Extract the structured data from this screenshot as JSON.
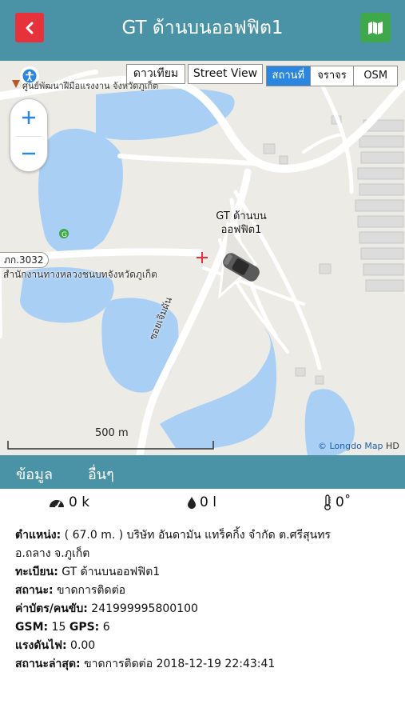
{
  "header": {
    "title": "GT ด้านบนออฟฟิต1",
    "colors": {
      "bar": "#4a92a5",
      "back": "#e5323b",
      "map_button": "#3fa84a"
    }
  },
  "map": {
    "satellite_label": "ดาวเทียม",
    "street_view_label": "Street View",
    "layers": [
      "สถานที่",
      "จราจร",
      "OSM"
    ],
    "active_layer": "สถานที่",
    "poi_top": "ศูนย์พัฒนาฝีมือแรงงาน จังหวัดภูเก็ต",
    "road_tag": "ภก.3032",
    "poi_office": "สำนักงานทางหลวงชนบทจังหวัดภูเก็ต",
    "street_name": "ซอยเจิมผัน",
    "vehicle_label": "GT ด้านบนออฟฟิต1",
    "scale": "500 m",
    "attribution": "© Longdo Map",
    "attribution_hd": "HD"
  },
  "tabs": [
    "ข้อมูล",
    "อื่นๆ"
  ],
  "stats": {
    "speed": "0 k",
    "fuel": "0 l",
    "temperature": "0˚"
  },
  "details": {
    "position_label": "ตำแหน่ง:",
    "position_value": " ( 67.0 m. ) บริษัท อันดามัน แทร็คกิ้ง จำกัด ต.ศรีสุนทร",
    "position_value2": "อ.ถลาง จ.ภูเก็ต",
    "registration_label": "ทะเบียน:",
    "registration_value": " GT ด้านบนออฟฟิต1",
    "status_label": "สถานะ:",
    "status_value": " ขาดการติดต่อ",
    "card_label": "ค่าบัตร/คนขับ:",
    "card_value": " 241999995800100",
    "gsm_label": "GSM:",
    "gsm_value": " 15 ",
    "gps_label": "GPS:",
    "gps_value": " 6",
    "voltage_label": "แรงดันไฟ:",
    "voltage_value": " 0.00",
    "latest_label": "สถานะล่าสุด:",
    "latest_value": " ขาดการติดต่อ 2018-12-19 22:43:41"
  }
}
